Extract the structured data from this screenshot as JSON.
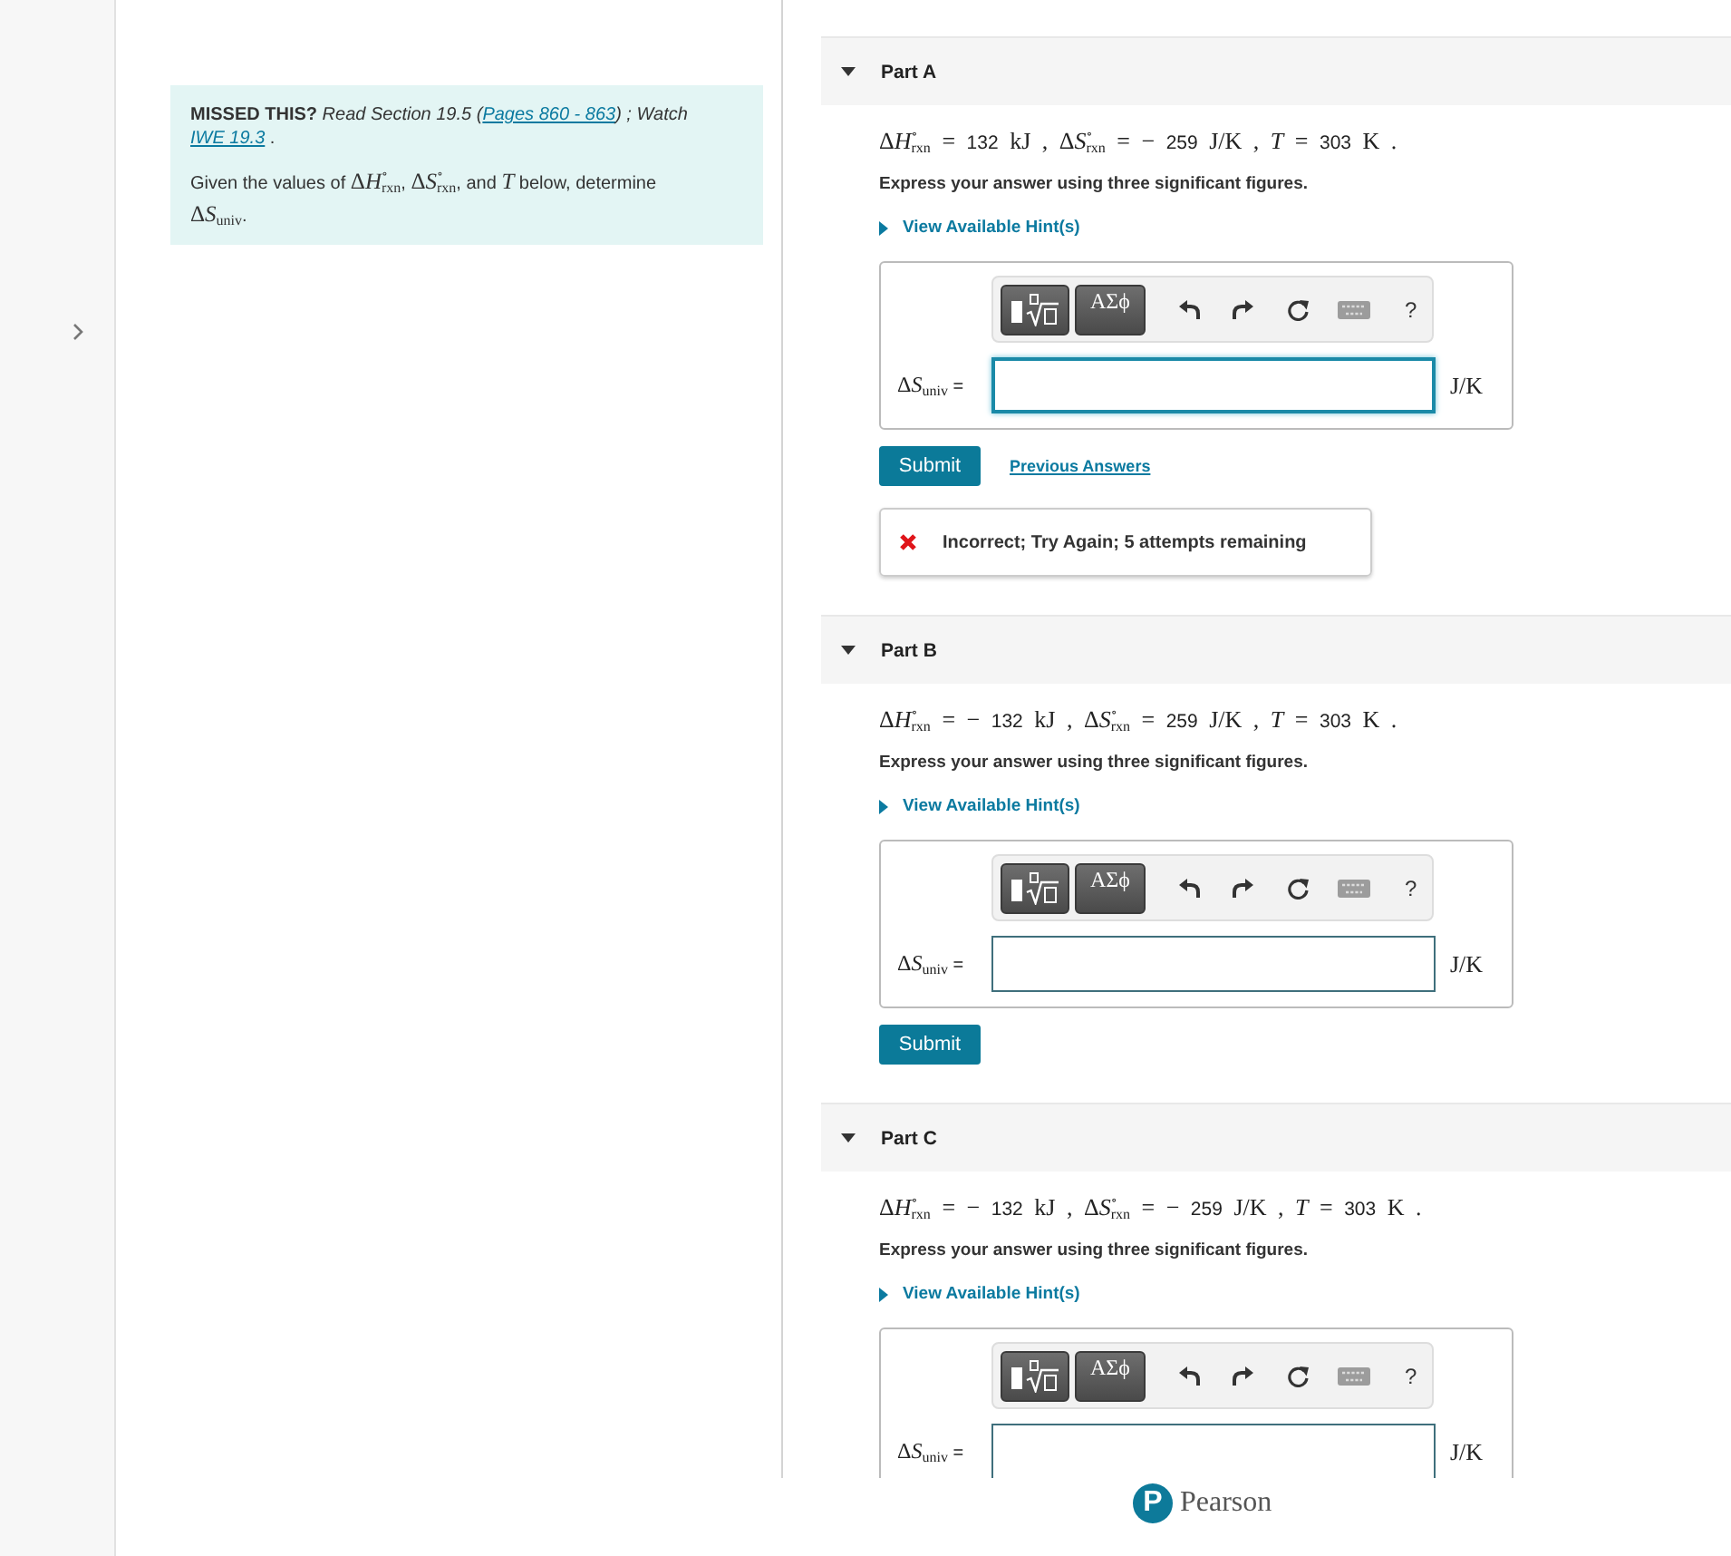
{
  "intro": {
    "missed": [
      {
        "kind": "bold",
        "text": "MISSED THIS?"
      },
      {
        "kind": "italic",
        "text": " Read Section 19.5 ("
      },
      {
        "kind": "link",
        "text": "Pages 860 - 863"
      },
      {
        "kind": "italic",
        "text": ") ; Watch "
      },
      {
        "kind": "link",
        "text": "IWE 19.3"
      },
      {
        "kind": "text",
        "text": " ."
      }
    ],
    "prompt": [
      {
        "kind": "text",
        "text": "Given the values of "
      },
      {
        "kind": "math",
        "text": "Δ"
      },
      {
        "kind": "var",
        "text": "H$^{∘}$$_{rxn}$"
      },
      {
        "kind": "text",
        "text": ", "
      },
      {
        "kind": "math",
        "text": "Δ"
      },
      {
        "kind": "var",
        "text": "S$^{∘}$$_{rxn}$"
      },
      {
        "kind": "text",
        "text": ", and "
      },
      {
        "kind": "var",
        "text": "T"
      },
      {
        "kind": "text",
        "text": " below, determine "
      },
      {
        "kind": "math",
        "text": "Δ"
      },
      {
        "kind": "var",
        "text": "S$_{univ}$"
      },
      {
        "kind": "text",
        "text": "."
      }
    ]
  },
  "parts": [
    {
      "title": "Part A",
      "expanded": true,
      "given": [
        {
          "kind": "math",
          "text": "Δ"
        },
        {
          "kind": "var",
          "text": "H$^{∘}$$_{rxn}$"
        },
        {
          "kind": "math",
          "text": " = "
        },
        {
          "kind": "num",
          "text": "132"
        },
        {
          "kind": "math",
          "text": " kJ , Δ"
        },
        {
          "kind": "var",
          "text": "S$^{∘}$$_{rxn}$"
        },
        {
          "kind": "math",
          "text": " = − "
        },
        {
          "kind": "num",
          "text": "259"
        },
        {
          "kind": "math",
          "text": " J/K , "
        },
        {
          "kind": "var",
          "text": "T"
        },
        {
          "kind": "math",
          "text": " = "
        },
        {
          "kind": "num",
          "text": "303"
        },
        {
          "kind": "math",
          "text": " K ."
        }
      ],
      "instruction": "Express your answer using three significant figures.",
      "hint": {
        "label": "View Available Hint(s)",
        "expanded": false
      },
      "toolbar": {
        "symbols": "ΑΣϕ",
        "help": "?"
      },
      "answer": {
        "label": [
          {
            "kind": "math",
            "text": "Δ"
          },
          {
            "kind": "var",
            "text": "S$_{univ}$"
          },
          {
            "kind": "text",
            "text": " ="
          }
        ],
        "unit": "J/K",
        "focused": true
      },
      "submit": "Submit",
      "previous_answers": "Previous Answers",
      "feedback": {
        "kind": "incorrect",
        "text": "Incorrect; Try Again; 5 attempts remaining"
      }
    },
    {
      "title": "Part B",
      "expanded": true,
      "given": [
        {
          "kind": "math",
          "text": "Δ"
        },
        {
          "kind": "var",
          "text": "H$^{∘}$$_{rxn}$"
        },
        {
          "kind": "math",
          "text": " = − "
        },
        {
          "kind": "num",
          "text": "132"
        },
        {
          "kind": "math",
          "text": " kJ , Δ"
        },
        {
          "kind": "var",
          "text": "S$^{∘}$$_{rxn}$"
        },
        {
          "kind": "math",
          "text": " = "
        },
        {
          "kind": "num",
          "text": "259"
        },
        {
          "kind": "math",
          "text": " J/K , "
        },
        {
          "kind": "var",
          "text": "T"
        },
        {
          "kind": "math",
          "text": " = "
        },
        {
          "kind": "num",
          "text": "303"
        },
        {
          "kind": "math",
          "text": " K ."
        }
      ],
      "instruction": "Express your answer using three significant figures.",
      "hint": {
        "label": "View Available Hint(s)",
        "expanded": false
      },
      "toolbar": {
        "symbols": "ΑΣϕ",
        "help": "?"
      },
      "answer": {
        "label": [
          {
            "kind": "math",
            "text": "Δ"
          },
          {
            "kind": "var",
            "text": "S$_{univ}$"
          },
          {
            "kind": "text",
            "text": " ="
          }
        ],
        "unit": "J/K",
        "focused": false
      },
      "submit": "Submit"
    },
    {
      "title": "Part C",
      "expanded": true,
      "given": [
        {
          "kind": "math",
          "text": "Δ"
        },
        {
          "kind": "var",
          "text": "H$^{∘}$$_{rxn}$"
        },
        {
          "kind": "math",
          "text": " = − "
        },
        {
          "kind": "num",
          "text": "132"
        },
        {
          "kind": "math",
          "text": " kJ , Δ"
        },
        {
          "kind": "var",
          "text": "S$^{∘}$$_{rxn}$"
        },
        {
          "kind": "math",
          "text": " = − "
        },
        {
          "kind": "num",
          "text": "259"
        },
        {
          "kind": "math",
          "text": " J/K , "
        },
        {
          "kind": "var",
          "text": "T"
        },
        {
          "kind": "math",
          "text": " = "
        },
        {
          "kind": "num",
          "text": "303"
        },
        {
          "kind": "math",
          "text": " K ."
        }
      ],
      "instruction": "Express your answer using three significant figures.",
      "hint": {
        "label": "View Available Hint(s)",
        "expanded": false
      },
      "toolbar": {
        "symbols": "ΑΣϕ",
        "help": "?"
      },
      "answer": {
        "label": [
          {
            "kind": "math",
            "text": "Δ"
          },
          {
            "kind": "var",
            "text": "S$_{univ}$"
          },
          {
            "kind": "text",
            "text": " ="
          }
        ],
        "unit": "J/K",
        "focused": false
      }
    }
  ],
  "footer": {
    "logo_mark": "P",
    "logo_text": "Pearson"
  }
}
